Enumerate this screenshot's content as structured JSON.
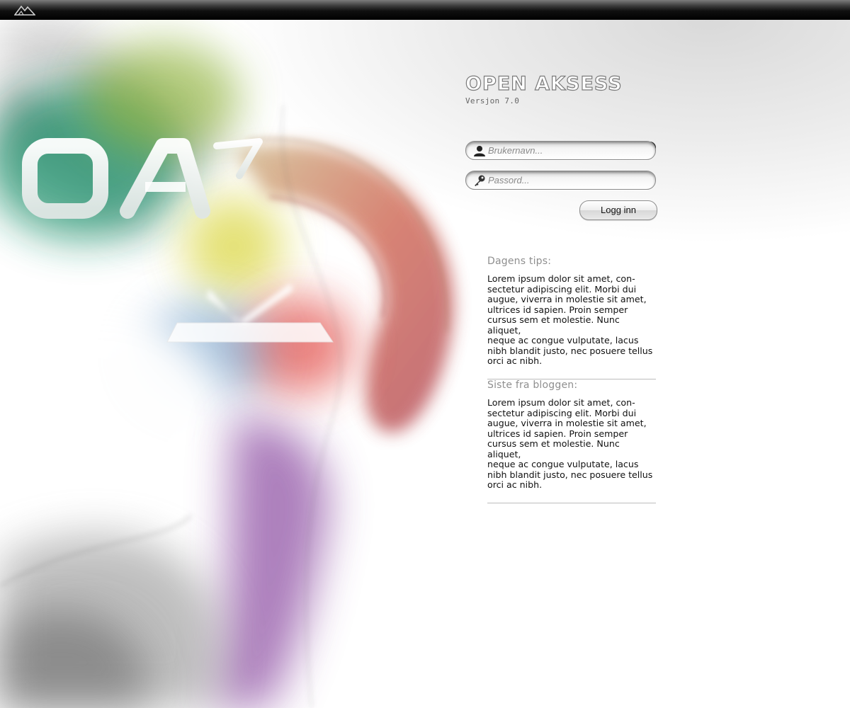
{
  "topbar": {
    "logo_icon": "mountain-logo-icon"
  },
  "hero": {
    "mark_text": "OA",
    "version_sup": "7"
  },
  "brand": {
    "title": "OPEN AKSESS",
    "version": "Versjon 7.0"
  },
  "help": {
    "icon": "help-icon",
    "glyph": "?"
  },
  "login": {
    "username_placeholder": "Brukernavn...",
    "password_placeholder": "Passord...",
    "submit_label": "Logg inn",
    "user_icon": "user-icon",
    "key_icon": "key-icon"
  },
  "news": [
    {
      "title": "Dagens tips:",
      "body": "Lorem ipsum dolor sit amet, con-\nsectetur adipiscing elit. Morbi dui\naugue, viverra in molestie sit amet,\nultrices id sapien. Proin semper\ncursus sem et molestie. Nunc aliquet,\nneque ac congue vulputate, lacus\nnibh blandit justo, nec posuere tellus\norci ac nibh."
    },
    {
      "title": "Siste fra bloggen:",
      "body": "Lorem ipsum dolor sit amet, con-\nsectetur adipiscing elit. Morbi dui\naugue, viverra in molestie sit amet,\nultrices id sapien. Proin semper\ncursus sem et molestie. Nunc aliquet,\nneque ac congue vulputate, lacus\nnibh blandit justo, nec posuere tellus\norci ac nibh."
    }
  ],
  "colors": {
    "topbar": "#000000",
    "heading_gray": "#8f8f8f",
    "text": "#111111"
  }
}
